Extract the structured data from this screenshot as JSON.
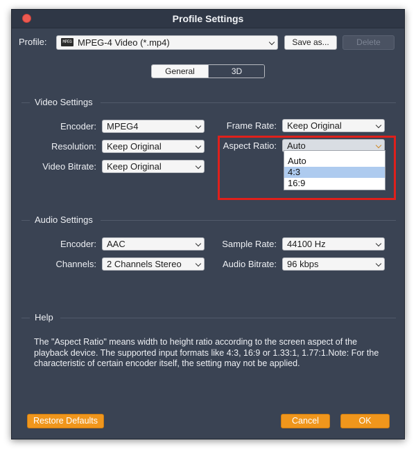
{
  "window": {
    "title": "Profile Settings"
  },
  "profile": {
    "label": "Profile:",
    "value": "MPEG-4 Video (*.mp4)",
    "icon_text": "MPEG",
    "save_as_label": "Save as...",
    "delete_label": "Delete"
  },
  "tabs": [
    {
      "label": "General",
      "active": true
    },
    {
      "label": "3D",
      "active": false
    }
  ],
  "video_settings": {
    "title": "Video Settings",
    "encoder": {
      "label": "Encoder:",
      "value": "MPEG4"
    },
    "resolution": {
      "label": "Resolution:",
      "value": "Keep Original"
    },
    "video_bitrate": {
      "label": "Video Bitrate:",
      "value": "Keep Original"
    },
    "frame_rate": {
      "label": "Frame Rate:",
      "value": "Keep Original"
    },
    "aspect_ratio": {
      "label": "Aspect Ratio:",
      "value": "Auto",
      "options": [
        "Auto",
        "4:3",
        "16:9"
      ],
      "highlighted_option": "4:3"
    }
  },
  "audio_settings": {
    "title": "Audio Settings",
    "encoder": {
      "label": "Encoder:",
      "value": "AAC"
    },
    "channels": {
      "label": "Channels:",
      "value": "2 Channels Stereo"
    },
    "sample_rate": {
      "label": "Sample Rate:",
      "value": "44100 Hz"
    },
    "audio_bitrate": {
      "label": "Audio Bitrate:",
      "value": "96 kbps"
    }
  },
  "help": {
    "title": "Help",
    "text": "The \"Aspect Ratio\" means width to height ratio according to the screen aspect of the playback device. The supported input formats like 4:3, 16:9 or 1.33:1, 1.77:1.Note: For the characteristic of certain encoder itself, the setting may not be applied."
  },
  "footer": {
    "restore_label": "Restore Defaults",
    "cancel_label": "Cancel",
    "ok_label": "OK"
  },
  "colors": {
    "window_bg": "#3a4353",
    "accent_orange": "#f0961c",
    "highlight_red": "#e0201b",
    "selected_option": "#aecbef"
  }
}
